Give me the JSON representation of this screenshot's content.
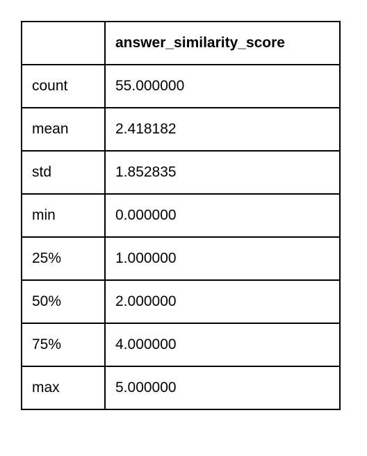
{
  "table": {
    "header": {
      "blank": "",
      "column": "answer_similarity_score"
    },
    "rows": [
      {
        "label": "count",
        "value": "55.000000"
      },
      {
        "label": "mean",
        "value": "2.418182"
      },
      {
        "label": "std",
        "value": "1.852835"
      },
      {
        "label": "min",
        "value": "0.000000"
      },
      {
        "label": "25%",
        "value": "1.000000"
      },
      {
        "label": "50%",
        "value": "2.000000"
      },
      {
        "label": "75%",
        "value": "4.000000"
      },
      {
        "label": "max",
        "value": "5.000000"
      }
    ]
  }
}
